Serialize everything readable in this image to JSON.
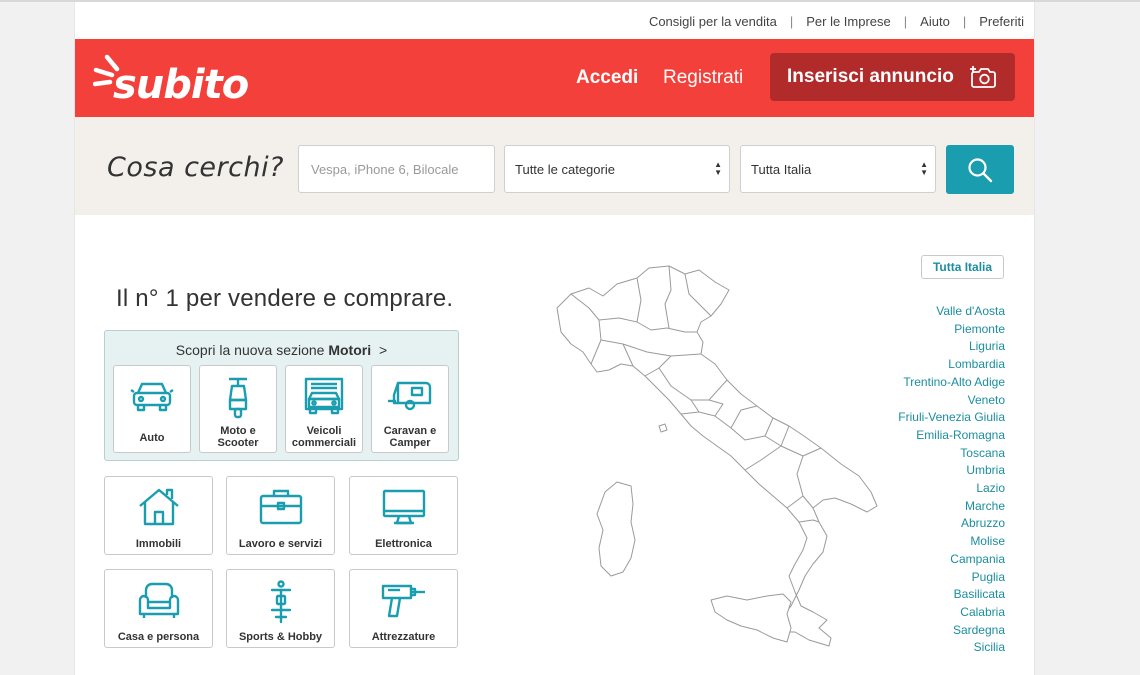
{
  "utility_links": [
    "Consigli per la vendita",
    "Per le Imprese",
    "Aiuto",
    "Preferiti"
  ],
  "header": {
    "logo_text": "subito",
    "login": "Accedi",
    "register": "Registrati",
    "post_ad": "Inserisci annuncio",
    "brand_color": "#f4403a"
  },
  "search": {
    "title": "Cosa cerchi?",
    "placeholder": "Vespa, iPhone 6, Bilocale",
    "category_selected": "Tutte le categorie",
    "location_selected": "Tutta Italia",
    "button_icon": "search-icon",
    "accent_color": "#1b9db0"
  },
  "tagline": "Il n° 1 per vendere e comprare.",
  "motori": {
    "intro": "Scopri la nuova sezione ",
    "bold": "Motori",
    "arrow": ">",
    "tiles": [
      {
        "label_1": "Auto",
        "label_2": "",
        "icon": "car-icon"
      },
      {
        "label_1": "Moto e",
        "label_2": "Scooter",
        "icon": "scooter-icon"
      },
      {
        "label_1": "Veicoli",
        "label_2": "commerciali",
        "icon": "van-icon"
      },
      {
        "label_1": "Caravan e",
        "label_2": "Camper",
        "icon": "caravan-icon"
      }
    ]
  },
  "categories": [
    {
      "label": "Immobili",
      "icon": "house-icon"
    },
    {
      "label": "Lavoro e servizi",
      "icon": "briefcase-icon"
    },
    {
      "label": "Elettronica",
      "icon": "monitor-icon"
    },
    {
      "label": "Casa e persona",
      "icon": "armchair-icon"
    },
    {
      "label": "Sports & Hobby",
      "icon": "bicycle-icon"
    },
    {
      "label": "Attrezzature",
      "icon": "drill-icon"
    }
  ],
  "map": {
    "all_italy": "Tutta Italia",
    "regions": [
      "Valle d'Aosta",
      "Piemonte",
      "Liguria",
      "Lombardia",
      "Trentino-Alto Adige",
      "Veneto",
      "Friuli-Venezia Giulia",
      "Emilia-Romagna",
      "Toscana",
      "Umbria",
      "Lazio",
      "Marche",
      "Abruzzo",
      "Molise",
      "Campania",
      "Puglia",
      "Basilicata",
      "Calabria",
      "Sardegna",
      "Sicilia"
    ]
  }
}
